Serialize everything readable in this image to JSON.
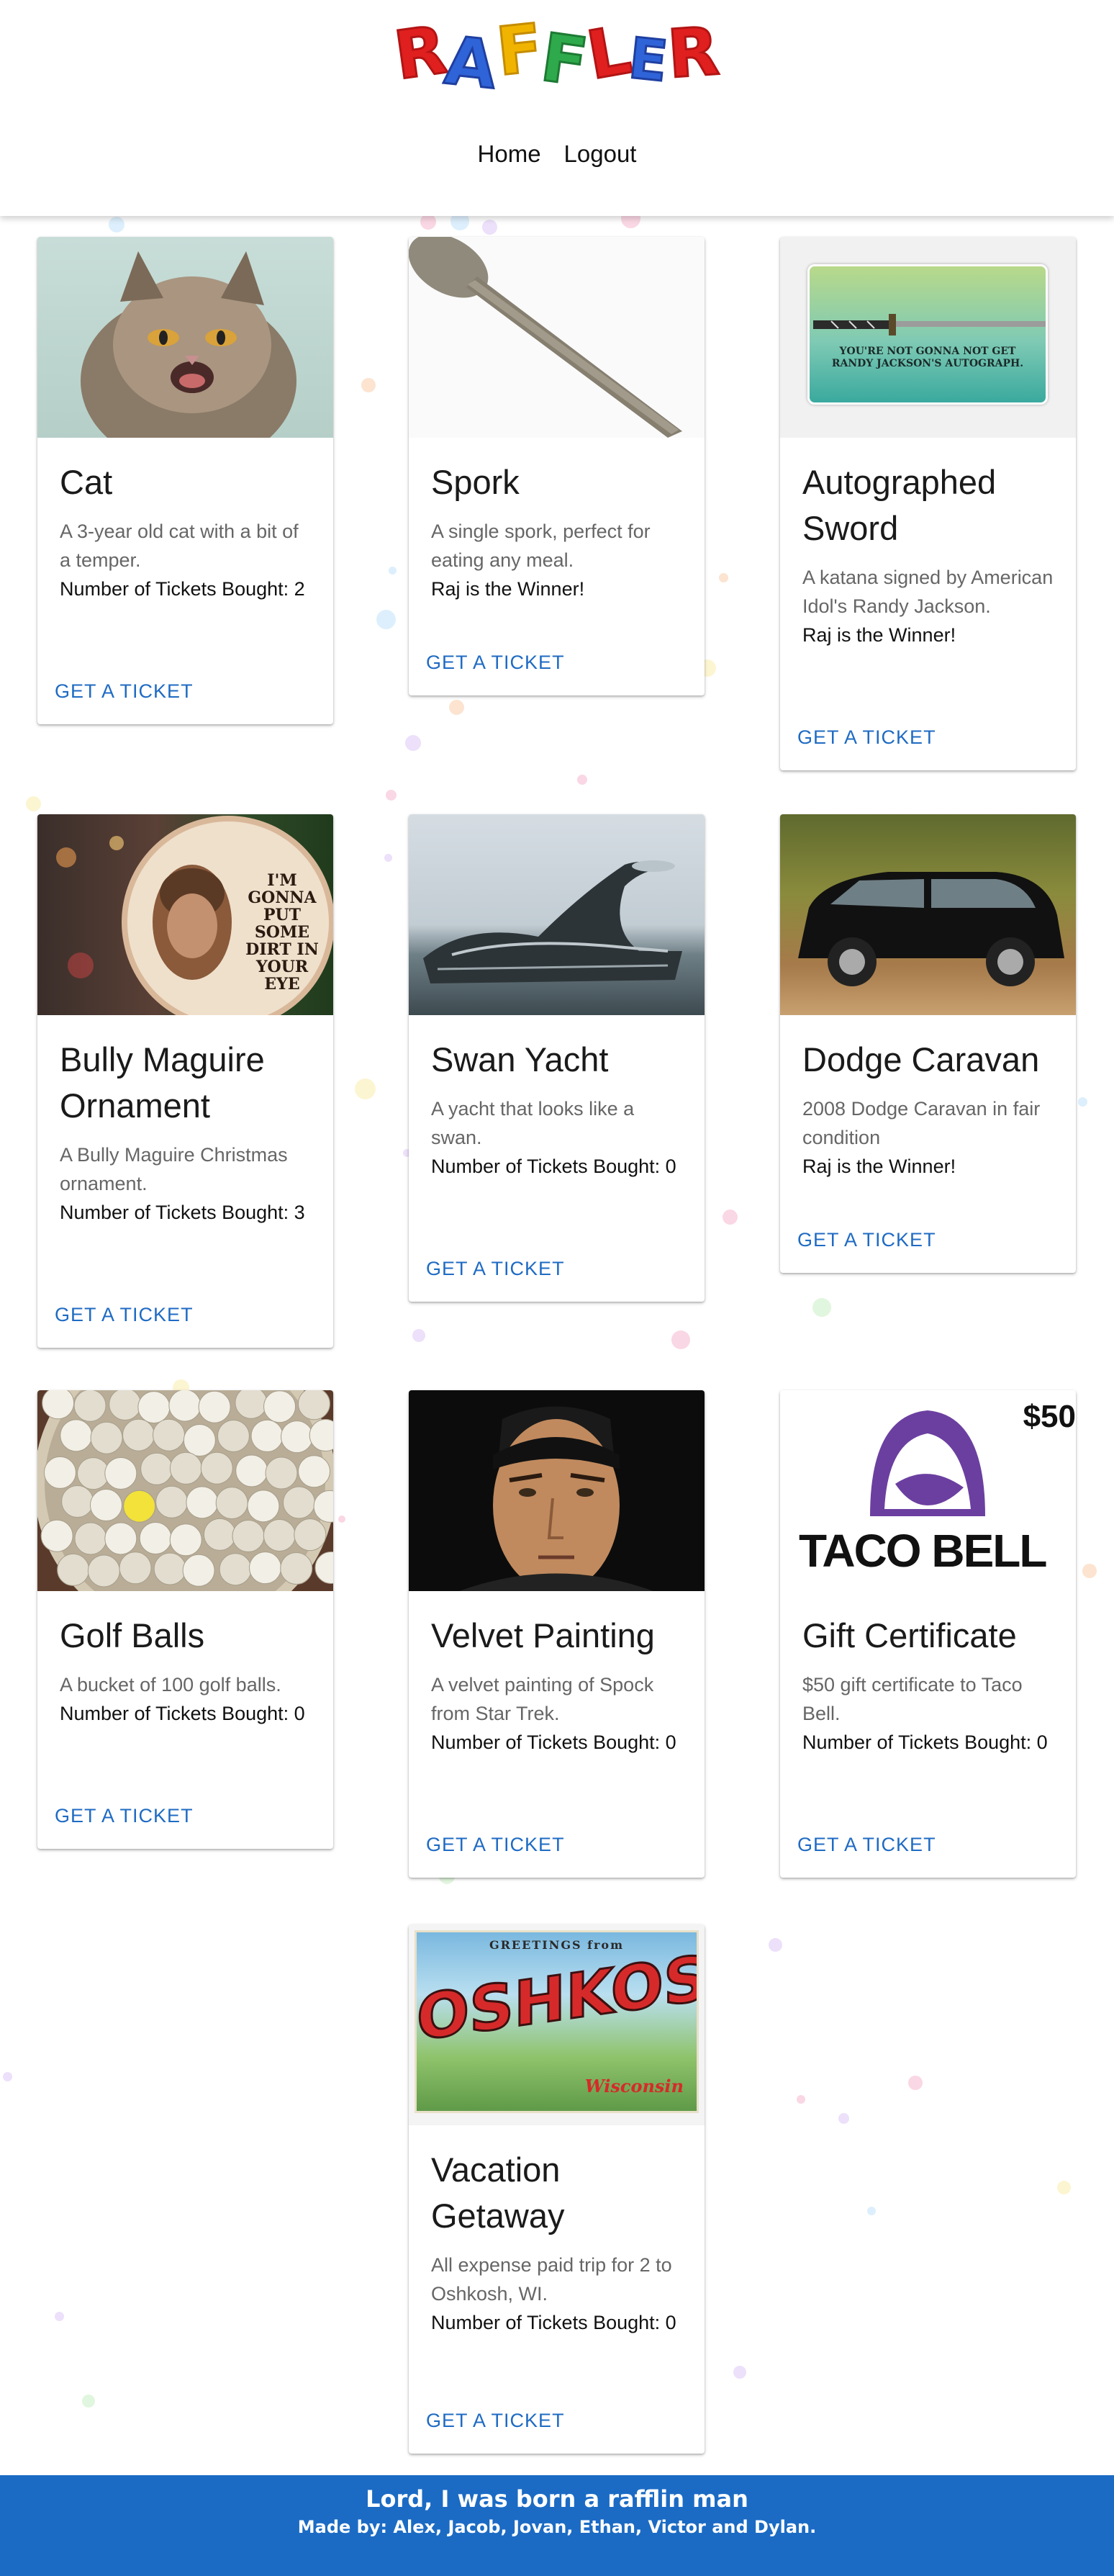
{
  "header": {
    "logo_letters": [
      "R",
      "A",
      "F",
      "F",
      "L",
      "E",
      "R"
    ],
    "logo_colors": [
      "#e01f1f",
      "#2f63d8",
      "#f0b400",
      "#2ea94b",
      "#e01f1f",
      "#2f63d8",
      "#e01f1f"
    ],
    "nav": [
      {
        "label": "Home"
      },
      {
        "label": "Logout"
      }
    ]
  },
  "items": [
    {
      "title": "Cat",
      "desc": "A 3-year old cat with a bit of a temper.",
      "status": "Number of Tickets Bought: 2",
      "action": "GET A TICKET"
    },
    {
      "title": "Spork",
      "desc": "A single spork, perfect for eating any meal.",
      "status": "Raj is the Winner!",
      "action": "GET A TICKET"
    },
    {
      "title": "Autographed Sword",
      "desc": "A katana signed by American Idol's Randy Jackson.",
      "status": "Raj is the Winner!",
      "action": "GET A TICKET",
      "image_text": "YOU'RE NOT GONNA NOT GET RANDY JACKSON'S AUTOGRAPH."
    },
    {
      "title": "Bully Maguire Ornament",
      "desc": "A Bully Maguire Christmas ornament.",
      "status": "Number of Tickets Bought: 3",
      "action": "GET A TICKET",
      "image_text": "I'M GONNA PUT SOME DIRT IN YOUR EYE"
    },
    {
      "title": "Swan Yacht",
      "desc": "A yacht that looks like a swan.",
      "status": "Number of Tickets Bought: 0",
      "action": "GET A TICKET"
    },
    {
      "title": "Dodge Caravan",
      "desc": "2008 Dodge Caravan in fair condition",
      "status": "Raj is the Winner!",
      "action": "GET A TICKET"
    },
    {
      "title": "Golf Balls",
      "desc": "A bucket of 100 golf balls.",
      "status": "Number of Tickets Bought: 0",
      "action": "GET A TICKET"
    },
    {
      "title": "Velvet Painting",
      "desc": "A velvet painting of Spock from Star Trek.",
      "status": "Number of Tickets Bought: 0",
      "action": "GET A TICKET"
    },
    {
      "title": "Gift Certificate",
      "desc": "$50 gift certificate to Taco Bell.",
      "status": "Number of Tickets Bought: 0",
      "action": "GET A TICKET",
      "image_text": "TACO BELL",
      "image_amount": "$50"
    },
    {
      "title": "Vacation Getaway",
      "desc": "All expense paid trip for 2 to Oshkosh, WI.",
      "status": "Number of Tickets Bought: 0",
      "action": "GET A TICKET",
      "image_text": "OSHKOSH",
      "image_greeting": "GREETINGS from",
      "image_state": "Wisconsin"
    }
  ],
  "footer": {
    "line1": "Lord, I was born a rafflin man",
    "line2": "Made by: Alex, Jacob, Jovan, Ethan, Victor and Dylan."
  },
  "colors": {
    "accent": "#1f6bc3",
    "footer_bg": "#1b6bc4"
  }
}
